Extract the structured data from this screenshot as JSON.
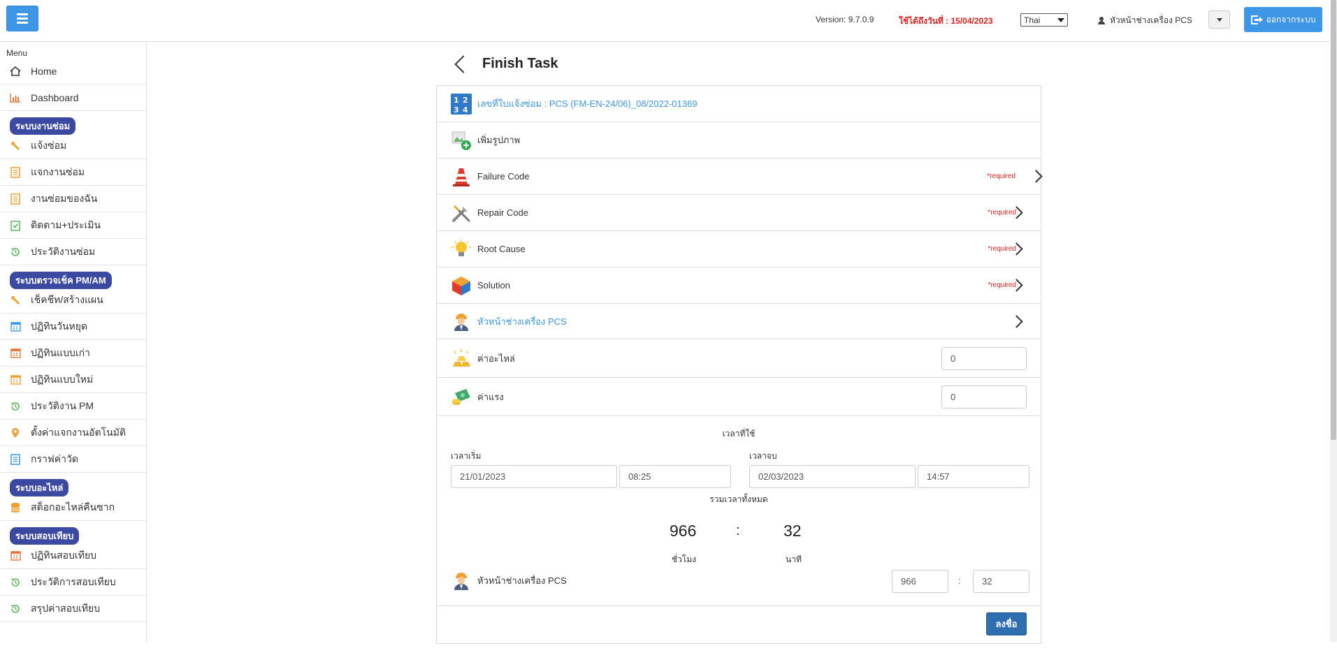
{
  "header": {
    "version": "Version: 9.7.0.9",
    "expire": "ใช้ได้ถึงวันที่ : 15/04/2023",
    "language": "Thai",
    "user": "หัวหน้าช่างเครื่อง PCS",
    "logout": "ออกจากระบบ"
  },
  "sidebar": {
    "menu_title": "Menu",
    "home": "Home",
    "dashboard": "Dashboard",
    "sections": [
      {
        "title": "ระบบงานซ่อม",
        "items": [
          "แจ้งซ่อม",
          "แจกงานซ่อม",
          "งานซ่อมของฉัน",
          "ติดตาม+ประเมิน",
          "ประวัติงานซ่อม"
        ]
      },
      {
        "title": "ระบบตรวจเช็ค PM/AM",
        "items": [
          "เช็คชีท/สร้างแผน",
          "ปฏิทินวันหยุด",
          "ปฏิทินแบบเก่า",
          "ปฏิทินแบบใหม่",
          "ประวัติงาน PM",
          "ตั้งค่าแจกงานอัตโนมัติ",
          "กราฟค่าวัด"
        ]
      },
      {
        "title": "ระบบอะไหล่",
        "items": [
          "สต็อกอะไหล่คืนซาก"
        ]
      },
      {
        "title": "ระบบสอบเทียบ",
        "items": [
          "ปฏิทินสอบเทียบ",
          "ประวัติการสอบเทียบ",
          "สรุปค่าสอบเทียบ"
        ]
      }
    ]
  },
  "page": {
    "title": "Finish Task",
    "ticket": "เลขที่ใบแจ้งซ่อม : PCS (FM-EN-24/06)_08/2022-01369",
    "add_image": "เพิ่มรูปภาพ",
    "failure_code": "Failure Code",
    "repair_code": "Repair Code",
    "root_cause": "Root Cause",
    "solution": "Solution",
    "required": "*required",
    "technician": "หัวหน้าช่างเครื่อง PCS",
    "parts_cost_label": "ค่าอะไหล่",
    "parts_cost": "0",
    "labor_cost_label": "ค่าแรง",
    "labor_cost": "0",
    "time": {
      "title": "เวลาที่ใช้",
      "start_label": "เวลาเริ่ม",
      "start_date": "21/01/2023",
      "start_time": "08:25",
      "end_label": "เวลาจบ",
      "end_date": "02/03/2023",
      "end_time": "14:57",
      "total_label": "รวมเวลาทั้งหมด",
      "hours": "966",
      "separator": ":",
      "minutes": "32",
      "hours_unit": "ชั่วโมง",
      "minutes_unit": "นาที",
      "person": "หัวหน้าช่างเครื่อง PCS",
      "person_hours": "966",
      "person_minutes": "32"
    },
    "submit": "ลงชื่อ"
  },
  "colors": {
    "primary": "#3d96e6",
    "section_badge": "#3b4aa0",
    "required": "#e02020",
    "submit": "#2f6fb0"
  }
}
